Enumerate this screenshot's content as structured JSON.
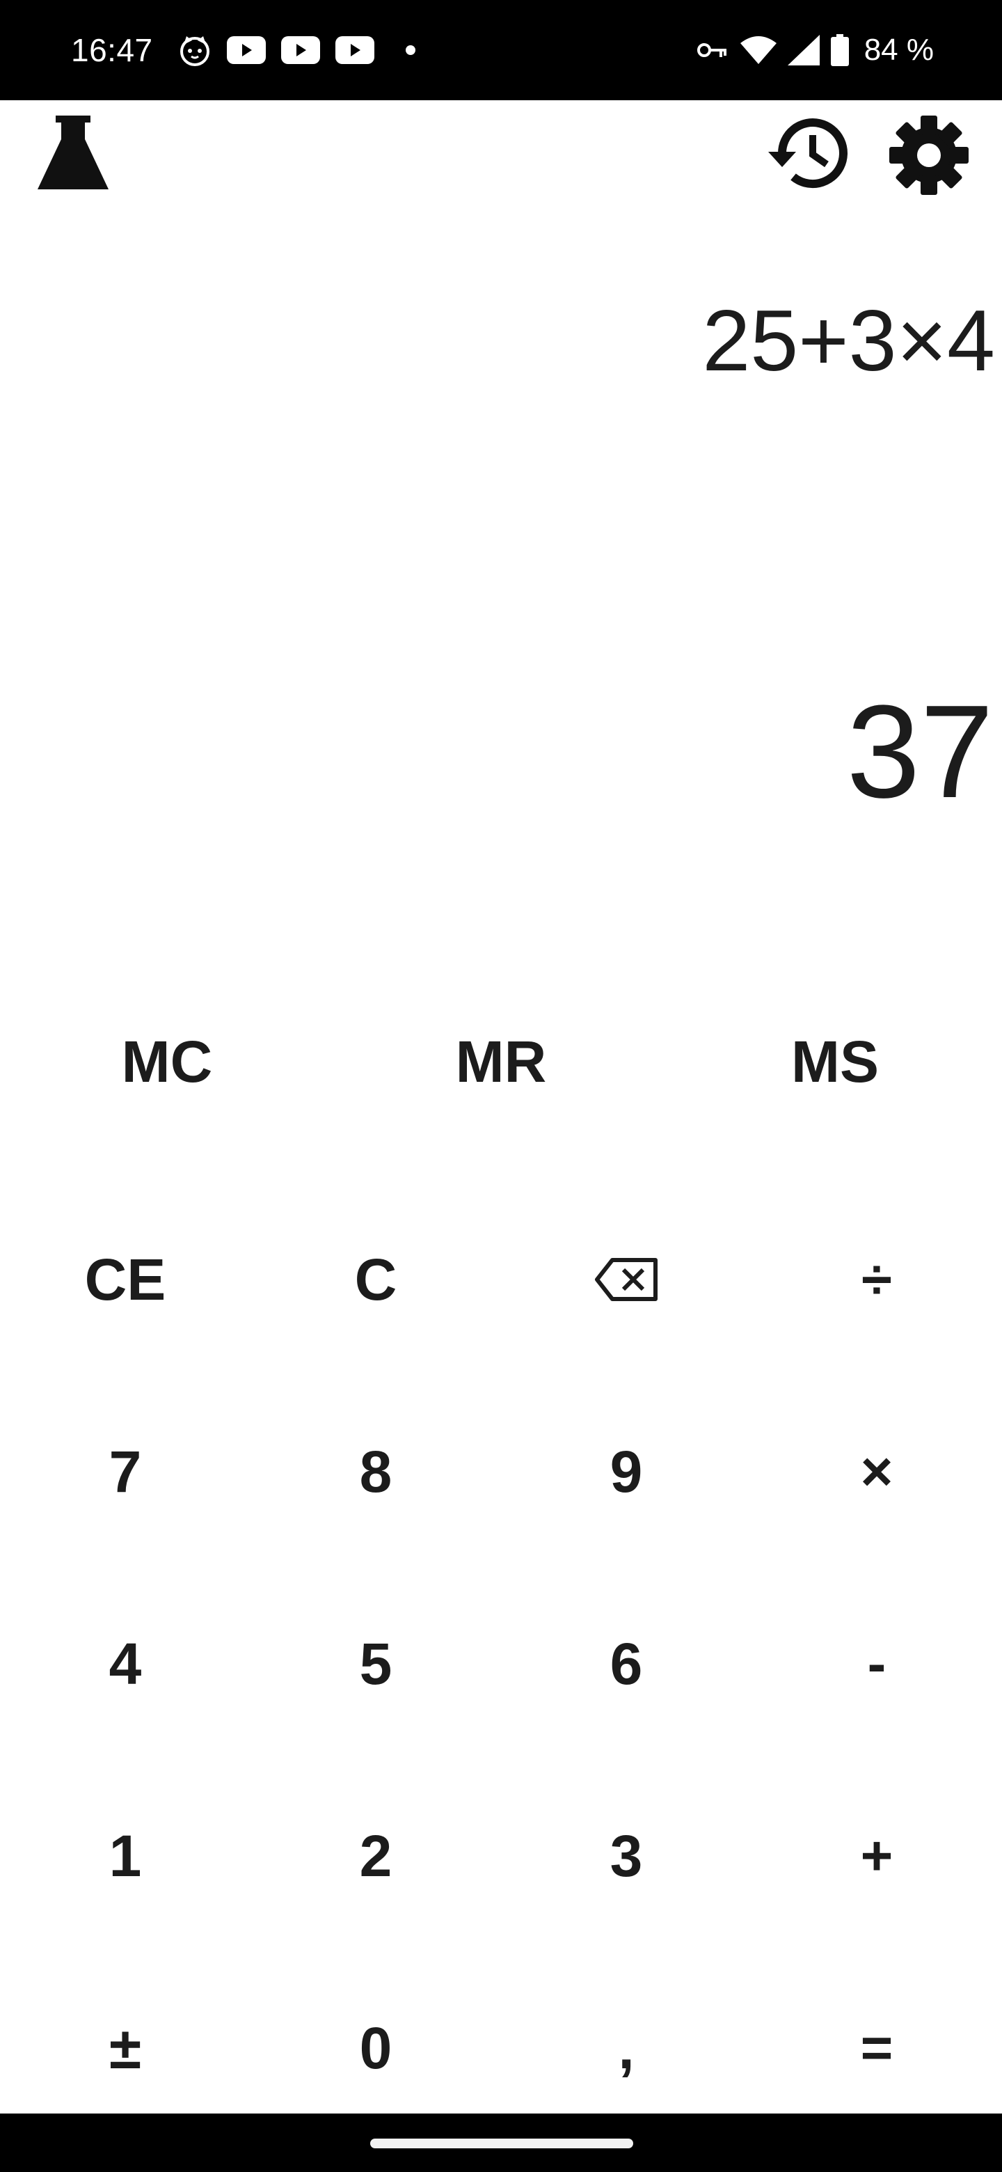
{
  "status_bar": {
    "time": "16:47",
    "notification_icons": [
      "cat-face-icon",
      "youtube-icon",
      "youtube-icon",
      "youtube-icon",
      "dot-icon"
    ],
    "system_icons": [
      "vpn-key-icon",
      "wifi-icon",
      "cell-signal-icon",
      "battery-icon"
    ],
    "battery": "84 %"
  },
  "toolbar": {
    "left_icon": "flask-icon",
    "right_icons": [
      "history-icon",
      "settings-gear-icon"
    ]
  },
  "display": {
    "expression": "25+3×4",
    "result": "37"
  },
  "memory_buttons": [
    "MC",
    "MR",
    "MS"
  ],
  "keypad": [
    [
      "CE",
      "C",
      "backspace-icon",
      "÷"
    ],
    [
      "7",
      "8",
      "9",
      "×"
    ],
    [
      "4",
      "5",
      "6",
      "-"
    ],
    [
      "1",
      "2",
      "3",
      "+"
    ],
    [
      "±",
      "0",
      ",",
      "="
    ]
  ],
  "keys": {
    "ce": "CE",
    "c": "C",
    "divide": "÷",
    "seven": "7",
    "eight": "8",
    "nine": "9",
    "multiply": "×",
    "four": "4",
    "five": "5",
    "six": "6",
    "minus": "-",
    "one": "1",
    "two": "2",
    "three": "3",
    "plus": "+",
    "plus_minus": "±",
    "zero": "0",
    "decimal": ",",
    "equals": "="
  },
  "colors": {
    "background": "#ffffff",
    "text": "#1c1c1c",
    "system_bars": "#000000"
  }
}
